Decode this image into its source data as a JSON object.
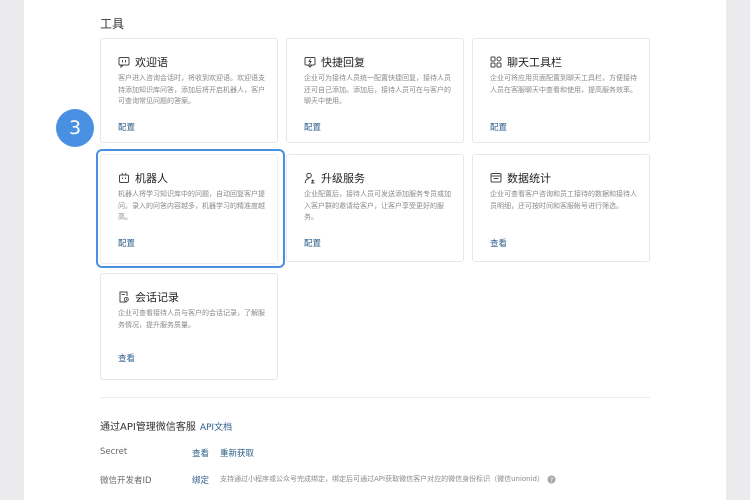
{
  "section": {
    "title": "工具"
  },
  "cards": [
    {
      "title": "欢迎语",
      "desc": "客户进入咨询会话时，将收到欢迎语。欢迎语支持添加知识库问答，添加后将开启机器人，客户可查询常见问题的答案。",
      "action": "配置",
      "icon": "message-bubble-icon"
    },
    {
      "title": "快捷回复",
      "desc": "企业可为接待人员统一配置快捷回复，接待人员还可自己添加。添加后，接待人员可在与客户的聊天中使用。",
      "action": "配置",
      "icon": "quick-reply-icon"
    },
    {
      "title": "聊天工具栏",
      "desc": "企业可将应用页面配置到聊天工具栏，方便接待人员在客服聊天中查看和使用，提高服务效率。",
      "action": "配置",
      "icon": "grid-icon"
    },
    {
      "title": "机器人",
      "desc": "机器人将学习知识库中的问题，自动回复客户提问。录入的问答内容越多，机器学习的精准度越高。",
      "action": "配置",
      "icon": "robot-icon"
    },
    {
      "title": "升级服务",
      "desc": "企业配置后，接待人员可发送添加服务专员或加入客户群的邀请给客户，让客户享受更好的服务。",
      "action": "配置",
      "icon": "upgrade-service-icon"
    },
    {
      "title": "数据统计",
      "desc": "企业可查看客户咨询和员工接待的数据和接待人员明细，还可按时间和客服帐号进行筛选。",
      "action": "查看",
      "icon": "statistics-icon"
    },
    {
      "title": "会话记录",
      "desc": "企业可查看接待人员与客户的会话记录，了解服务情况，提升服务质量。",
      "action": "查看",
      "icon": "chat-record-icon"
    }
  ],
  "step": {
    "number": "3"
  },
  "api": {
    "title": "通过API管理微信客服",
    "doc_link": "API文档",
    "secret_label": "Secret",
    "secret_view": "查看",
    "secret_refresh": "重新获取",
    "dev_label": "微信开发者ID",
    "dev_bind": "绑定",
    "dev_note": "支持通过小程序或公众号完成绑定，绑定后可通过API获取微信客户对应的微信身份标识（微信unionid）"
  },
  "colors": {
    "accent": "#4a90e2",
    "link": "#2d5c8a"
  }
}
